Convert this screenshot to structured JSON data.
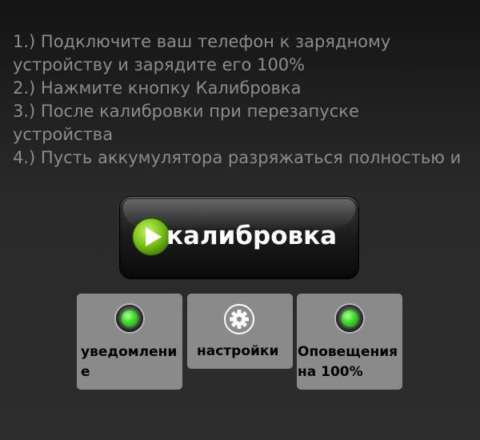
{
  "instructions": {
    "line1": "1.) Подключите ваш телефон к зарядному",
    "line2": "устройству и зарядите его 100%",
    "line3": "2.) Нажмите кнопку Калибровка",
    "line4": "3.) После калибровки при перезапуске",
    "line5": "устройства",
    "line6": "4.) Пусть аккумулятора разряжаться полностью и"
  },
  "calibrate_button": {
    "label": "калибровка",
    "icon": "play-icon"
  },
  "tiles": {
    "notification": {
      "label_l1": "уведомлени",
      "label_l2": "е",
      "icon": "green-led-icon"
    },
    "settings": {
      "label": "настройки",
      "icon": "gear-icon"
    },
    "alert100": {
      "label_l1": "Оповещения",
      "label_l2": "на 100%",
      "icon": "green-led-icon"
    }
  },
  "colors": {
    "accent_green": "#3fdc2c",
    "text_gray": "#8c8c8c",
    "tile_gray": "#8a8a8a"
  }
}
